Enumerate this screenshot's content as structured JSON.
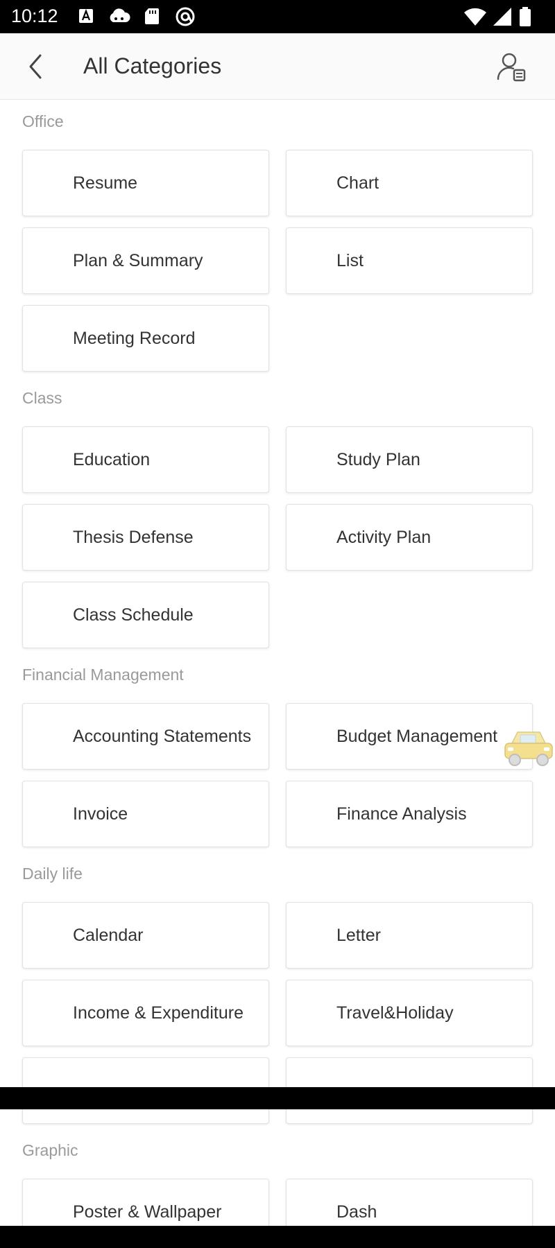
{
  "status_bar": {
    "time": "10:12",
    "left_icons": [
      "a-icon",
      "cloud-icon",
      "sd-card-icon",
      "at-icon"
    ],
    "right_icons": [
      "wifi-icon",
      "signal-icon",
      "battery-icon"
    ]
  },
  "header": {
    "title": "All Categories",
    "back_icon": "chevron-left-icon",
    "profile_icon": "user-list-icon"
  },
  "sections": [
    {
      "label": "Office",
      "items": [
        "Resume",
        "Chart",
        "Plan & Summary",
        "List",
        "Meeting Record"
      ]
    },
    {
      "label": "Class",
      "items": [
        "Education",
        "Study Plan",
        "Thesis Defense",
        "Activity Plan",
        "Class Schedule"
      ]
    },
    {
      "label": "Financial Management",
      "items": [
        "Accounting Statements",
        "Budget Management",
        "Invoice",
        "Finance Analysis"
      ]
    },
    {
      "label": "Daily life",
      "items": [
        "Calendar",
        "Letter",
        "Income & Expenditure",
        "Travel&Holiday"
      ]
    },
    {
      "label": "Graphic",
      "items": [
        "Poster & Wallpaper",
        "Dash"
      ]
    }
  ],
  "floating_icon": "taxi-icon",
  "colors": {
    "status_bar": "#000000",
    "app_bar": "#fafafa",
    "section_label": "#9a9a9a",
    "tile_text": "#333333",
    "tile_border": "#e2e2e2"
  }
}
